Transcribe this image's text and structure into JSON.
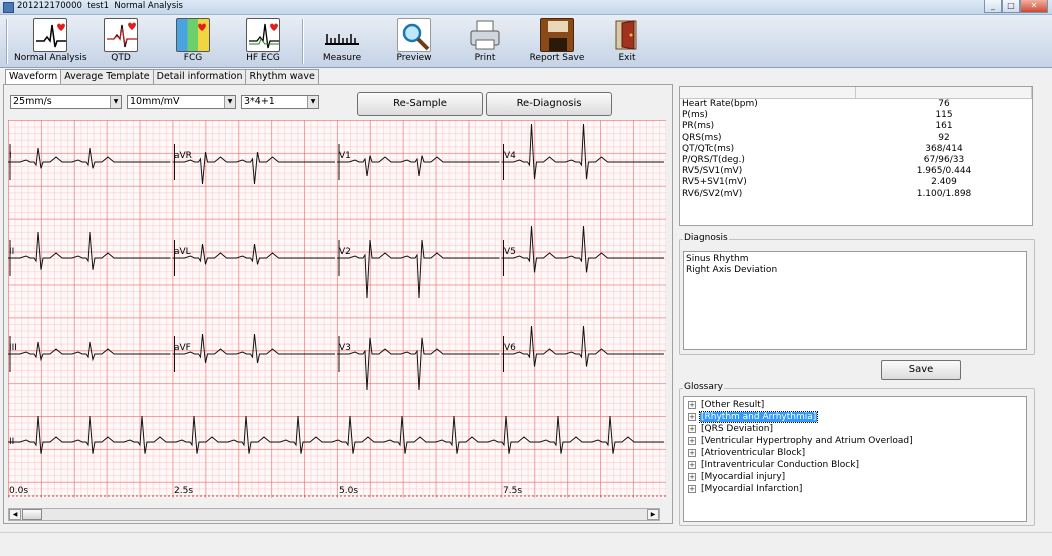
{
  "window": {
    "title": "201212170000  test1  Normal Analysis"
  },
  "toolbar": [
    {
      "label": "Normal Analysis",
      "icon": "ecg-heart-icon"
    },
    {
      "label": "QTD",
      "icon": "qtd-icon"
    },
    {
      "label": "FCG",
      "icon": "fcg-icon"
    },
    {
      "label": "HF ECG",
      "icon": "hf-ecg-icon"
    },
    {
      "label": "Measure",
      "icon": "ruler-icon"
    },
    {
      "label": "Preview",
      "icon": "magnifier-icon"
    },
    {
      "label": "Print",
      "icon": "printer-icon"
    },
    {
      "label": "Report Save",
      "icon": "floppy-icon"
    },
    {
      "label": "Exit",
      "icon": "door-icon"
    }
  ],
  "tabs": [
    "Waveform",
    "Average Template",
    "Detail information",
    "Rhythm wave"
  ],
  "controls": {
    "speed": "25mm/s",
    "gain": "10mm/mV",
    "layout": "3*4+1",
    "resample_label": "Re-Sample",
    "rediagnosis_label": "Re-Diagnosis"
  },
  "leads": {
    "row1": [
      "I",
      "aVR",
      "V1",
      "V4"
    ],
    "row2": [
      "II",
      "aVL",
      "V2",
      "V5"
    ],
    "row3": [
      "III",
      "aVF",
      "V3",
      "V6"
    ],
    "row4": [
      "II"
    ]
  },
  "time_axis": [
    "0.0s",
    "2.5s",
    "5.0s",
    "7.5s"
  ],
  "params": [
    {
      "name": "Heart Rate(bpm)",
      "value": "76"
    },
    {
      "name": "P(ms)",
      "value": "115"
    },
    {
      "name": "PR(ms)",
      "value": "161"
    },
    {
      "name": "QRS(ms)",
      "value": "92"
    },
    {
      "name": "QT/QTc(ms)",
      "value": "368/414"
    },
    {
      "name": "P/QRS/T(deg.)",
      "value": "67/96/33"
    },
    {
      "name": "RV5/SV1(mV)",
      "value": "1.965/0.444"
    },
    {
      "name": "RV5+SV1(mV)",
      "value": "2.409"
    },
    {
      "name": "RV6/SV2(mV)",
      "value": "1.100/1.898"
    }
  ],
  "diagnosis": {
    "title": "Diagnosis",
    "lines": [
      "Sinus Rhythm",
      "Right Axis Deviation"
    ],
    "save_label": "Save"
  },
  "glossary": {
    "title": "Glossary",
    "items": [
      "[Other Result]",
      "[Rhythm and Arrhythmia]",
      "[QRS Deviation]",
      "[Ventricular Hypertrophy and Atrium  Overload]",
      "[Atrioventricular Block]",
      "[Intraventricular Conduction Block]",
      "[Myocardial injury]",
      "[Myocardial Infarction]"
    ],
    "selected_index": 1
  },
  "colors": {
    "grid_major": "#eb6e6e",
    "grid_minor": "#f5aaaa",
    "selection": "#3399ff"
  }
}
